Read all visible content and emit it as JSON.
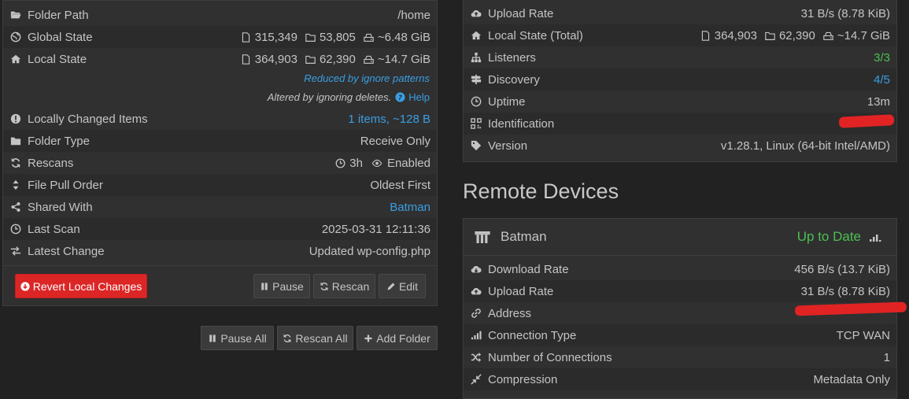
{
  "folder": {
    "rows": [
      {
        "label": "Folder Path",
        "value": "/home",
        "icon": "folder-open-icon"
      },
      {
        "label": "Global State",
        "icon": "globe-icon",
        "files": "315,349",
        "dirs": "53,805",
        "size": "~6.48 GiB"
      },
      {
        "label": "Local State",
        "icon": "home-icon",
        "files": "364,903",
        "dirs": "62,390",
        "size": "~14.7 GiB"
      }
    ],
    "reduced_note": "Reduced by ignore patterns",
    "altered_note": "Altered by ignoring deletes.",
    "help_label": "Help",
    "rows2": [
      {
        "label": "Locally Changed Items",
        "value": "1 items, ~128 B",
        "icon": "exclamation-circle-icon"
      },
      {
        "label": "Folder Type",
        "value": "Receive Only",
        "icon": "folder-icon"
      },
      {
        "label": "Rescans",
        "icon": "refresh-icon",
        "interval": "3h",
        "watch": "Enabled"
      },
      {
        "label": "File Pull Order",
        "value": "Oldest First",
        "icon": "sort-icon"
      },
      {
        "label": "Shared With",
        "value": "Batman",
        "icon": "share-icon"
      },
      {
        "label": "Last Scan",
        "value": "2025-03-31 12:11:36",
        "icon": "clock-icon"
      },
      {
        "label": "Latest Change",
        "value": "Updated wp-config.php",
        "icon": "exchange-icon"
      }
    ],
    "buttons": {
      "revert": "Revert Local Changes",
      "pause": "Pause",
      "rescan": "Rescan",
      "edit": "Edit"
    }
  },
  "global_buttons": {
    "pause_all": "Pause All",
    "rescan_all": "Rescan All",
    "add_folder": "Add Folder"
  },
  "this_device": {
    "rows": [
      {
        "label": "Upload Rate",
        "value": "31 B/s (8.78 KiB)",
        "icon": "cloud-upload-icon"
      },
      {
        "label": "Local State (Total)",
        "icon": "home-icon",
        "files": "364,903",
        "dirs": "62,390",
        "size": "~14.7 GiB"
      },
      {
        "label": "Listeners",
        "value": "3/3",
        "icon": "sitemap-icon"
      },
      {
        "label": "Discovery",
        "value": "4/5",
        "icon": "signpost-icon"
      },
      {
        "label": "Uptime",
        "value": "13m",
        "icon": "clock-icon"
      },
      {
        "label": "Identification",
        "value": "",
        "icon": "qrcode-icon"
      },
      {
        "label": "Version",
        "value": "v1.28.1, Linux (64-bit Intel/AMD)",
        "icon": "tag-icon"
      }
    ]
  },
  "remote": {
    "title": "Remote Devices",
    "device_name": "Batman",
    "device_status": "Up to Date",
    "rows": [
      {
        "label": "Download Rate",
        "value": "456 B/s (13.7 KiB)",
        "icon": "cloud-download-icon"
      },
      {
        "label": "Upload Rate",
        "value": "31 B/s (8.78 KiB)",
        "icon": "cloud-upload-icon"
      },
      {
        "label": "Address",
        "value": "",
        "icon": "link-icon"
      },
      {
        "label": "Connection Type",
        "value": "TCP WAN",
        "icon": "signal-icon"
      },
      {
        "label": "Number of Connections",
        "value": "1",
        "icon": "random-icon"
      },
      {
        "label": "Compression",
        "value": "Metadata Only",
        "icon": "compress-icon"
      }
    ]
  },
  "colors": {
    "accent_blue": "#3a9ee4",
    "accent_green": "#4cc052",
    "danger_red": "#dc2626"
  }
}
